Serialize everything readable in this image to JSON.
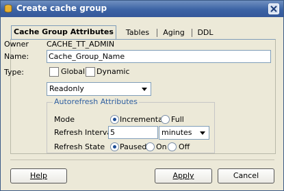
{
  "window": {
    "title": "Create cache group"
  },
  "tabs": [
    {
      "label": "Cache Group Attributes"
    },
    {
      "label": "Tables"
    },
    {
      "label": "Aging"
    },
    {
      "label": "DDL"
    }
  ],
  "form": {
    "owner_label": "Owner",
    "owner_value": "CACHE_TT_ADMIN",
    "name_label": "Name:",
    "name_value": "Cache_Group_Name",
    "type_label": "Type:",
    "global_label": "Global",
    "global_checked": false,
    "dynamic_label": "Dynamic",
    "dynamic_checked": false,
    "mode_select_value": "Readonly"
  },
  "autorefresh": {
    "legend": "Autorefresh Attributes",
    "mode_label": "Mode",
    "mode_incremental": "Incremental",
    "mode_full": "Full",
    "mode_selected": "Incremental",
    "interval_label": "Refresh Interval",
    "interval_value": "5",
    "interval_unit": "minutes",
    "state_label": "Refresh State",
    "state_paused": "Paused",
    "state_on": "On",
    "state_off": "Off",
    "state_selected": "Paused"
  },
  "buttons": {
    "help": "Help",
    "apply": "Apply",
    "cancel": "Cancel"
  }
}
